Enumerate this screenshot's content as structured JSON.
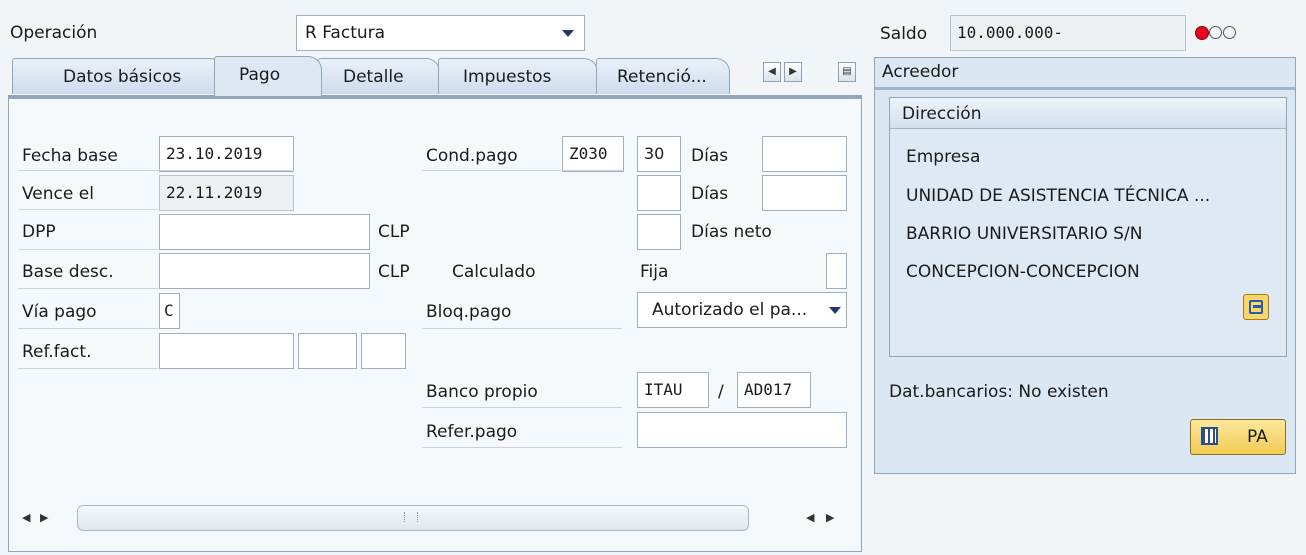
{
  "header": {
    "operacion_label": "Operación",
    "operacion_value": "R Factura",
    "saldo_label": "Saldo",
    "saldo_value": "10.000.000-"
  },
  "tabs": [
    {
      "label": "Datos básicos"
    },
    {
      "label": "Pago"
    },
    {
      "label": "Detalle"
    },
    {
      "label": "Impuestos"
    },
    {
      "label": "Retenció..."
    }
  ],
  "pago": {
    "fecha_base_label": "Fecha base",
    "fecha_base_value": "23.10.2019",
    "vence_label": "Vence el",
    "vence_value": "22.11.2019",
    "dpp_label": "DPP",
    "dpp_currency": "CLP",
    "base_desc_label": "Base desc.",
    "base_desc_currency": "CLP",
    "via_pago_label": "Vía pago",
    "via_pago_value": "C",
    "ref_fact_label": "Ref.fact.",
    "cond_pago_label": "Cond.pago",
    "cond_pago_code": "Z030",
    "cond_pago_days1": "30",
    "dias1_label": "Días",
    "dias2_label": "Días",
    "dias_neto_label": "Días neto",
    "calculado_label": "Calculado",
    "fija_label": "Fija",
    "bloq_pago_label": "Bloq.pago",
    "bloq_pago_value": "Autorizado el pa...",
    "banco_propio_label": "Banco propio",
    "banco_value": "ITAU",
    "banco_separator": "/",
    "banco_account": "AD017",
    "refer_pago_label": "Refer.pago"
  },
  "acreedor": {
    "title": "Acreedor",
    "direccion_title": "Dirección",
    "address_lines": [
      "Empresa",
      "UNIDAD DE ASISTENCIA TÉCNICA ...",
      "BARRIO UNIVERSITARIO S/N",
      "CONCEPCION-CONCEPCION"
    ],
    "dat_bancarios": "Dat.bancarios: No existen",
    "pa_button": "PA"
  },
  "colors": {
    "panel_border": "#8fa6bd",
    "status_red": "#e8001c",
    "button_yellow": "#f7d66a"
  }
}
